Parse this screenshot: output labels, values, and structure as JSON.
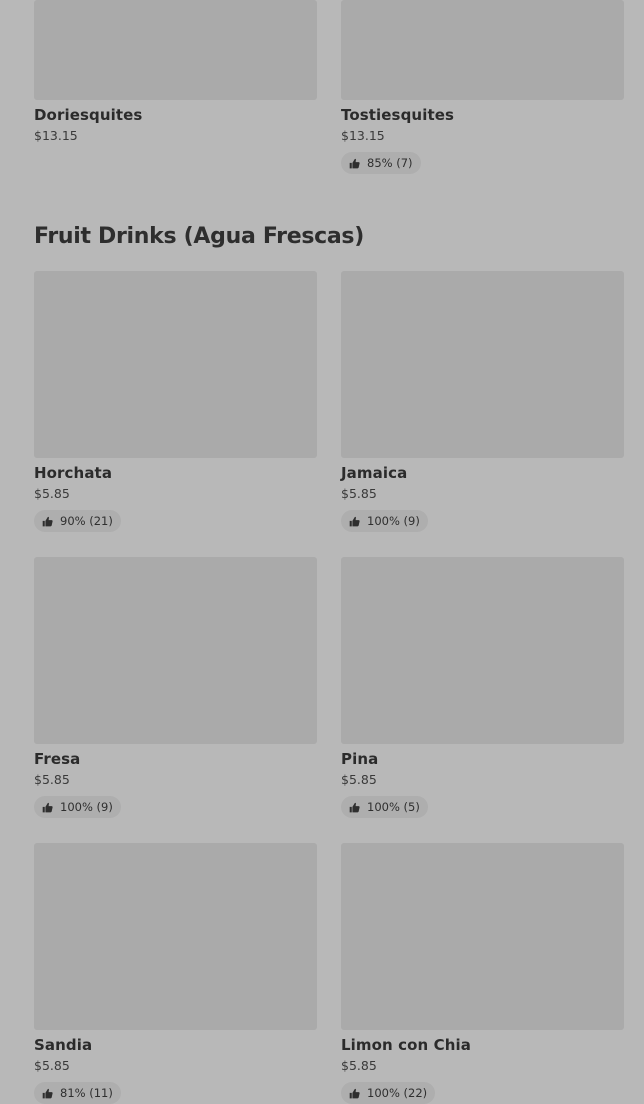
{
  "top_items": [
    {
      "name": "Doriesquites",
      "price": "$13.15"
    },
    {
      "name": "Tostiesquites",
      "price": "$13.15",
      "rating": "85% (7)"
    }
  ],
  "section": {
    "title": "Fruit Drinks (Agua Frescas)",
    "items": [
      {
        "name": "Horchata",
        "price": "$5.85",
        "rating": "90% (21)"
      },
      {
        "name": "Jamaica",
        "price": "$5.85",
        "rating": "100% (9)"
      },
      {
        "name": "Fresa",
        "price": "$5.85",
        "rating": "100% (9)"
      },
      {
        "name": "Pina",
        "price": "$5.85",
        "rating": "100% (5)"
      },
      {
        "name": "Sandia",
        "price": "$5.85",
        "rating": "81% (11)"
      },
      {
        "name": "Limon con Chia",
        "price": "$5.85",
        "rating": "100% (22)"
      }
    ]
  },
  "icons": {
    "rating": "thumbs-up-icon"
  },
  "colors": {
    "background": "#b8b8b8",
    "image_placeholder": "#aaaaaa",
    "badge": "#aeaeae"
  }
}
